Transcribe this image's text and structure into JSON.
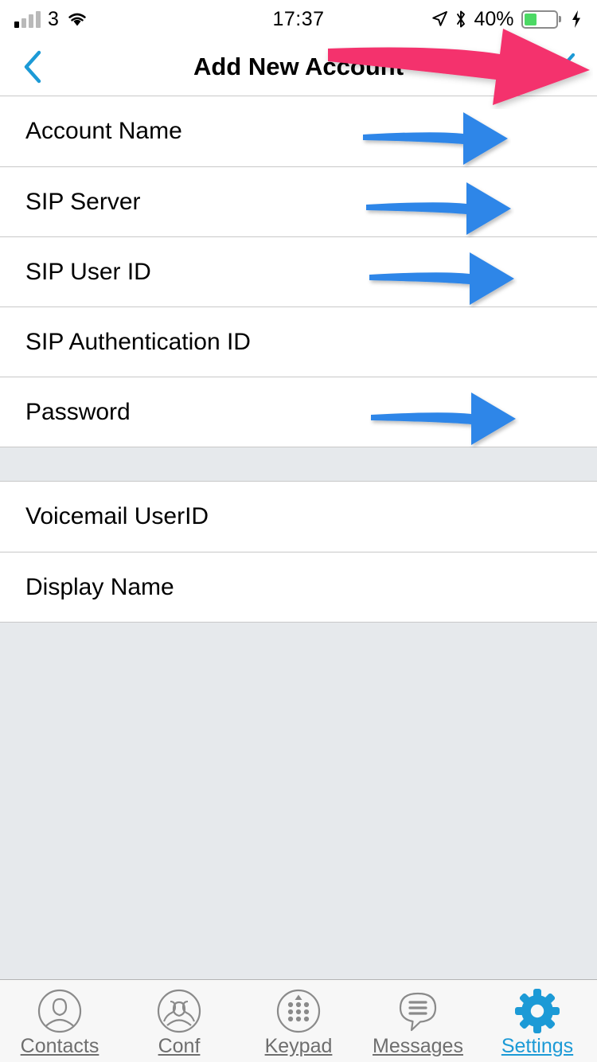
{
  "status_bar": {
    "carrier": "3",
    "signal_bars_total": 4,
    "signal_bars_filled": 1,
    "time": "17:37",
    "battery_percent": "40%",
    "battery_level": 40,
    "battery_color": "#4CD964",
    "charging": true,
    "icons": [
      "signal-bars-icon",
      "wifi-icon",
      "location-arrow-icon",
      "bluetooth-icon",
      "battery-icon",
      "charging-bolt-icon"
    ]
  },
  "nav_bar": {
    "back_label": "‹",
    "title": "Add New Account",
    "confirm_label": "✓",
    "accent_color": "#1C9AD6"
  },
  "form": {
    "groups": [
      {
        "rows": [
          {
            "label": "Account Name",
            "annotated": true
          },
          {
            "label": "SIP Server",
            "annotated": true
          },
          {
            "label": "SIP User ID",
            "annotated": true
          },
          {
            "label": "SIP Authentication ID",
            "annotated": false
          },
          {
            "label": "Password",
            "annotated": true
          }
        ]
      },
      {
        "rows": [
          {
            "label": "Voicemail UserID",
            "annotated": false
          },
          {
            "label": "Display Name",
            "annotated": false
          }
        ]
      }
    ]
  },
  "annotations": {
    "pink_arrow": {
      "target": "confirm-checkmark",
      "color": "#F4336D"
    },
    "blue_arrow_color": "#2E86E8",
    "blue_arrow_targets": [
      "Account Name",
      "SIP Server",
      "SIP User ID",
      "Password"
    ]
  },
  "tab_bar": {
    "items": [
      {
        "label": "Contacts",
        "icon": "contact-person-icon",
        "active": false
      },
      {
        "label": "Conf",
        "icon": "conference-group-icon",
        "active": false
      },
      {
        "label": "Keypad",
        "icon": "keypad-dots-icon",
        "active": false
      },
      {
        "label": "Messages",
        "icon": "message-bubble-icon",
        "active": false
      },
      {
        "label": "Settings",
        "icon": "gear-icon",
        "active": true
      }
    ],
    "active_color": "#1C9AD6",
    "inactive_color": "#8a8a8a"
  }
}
